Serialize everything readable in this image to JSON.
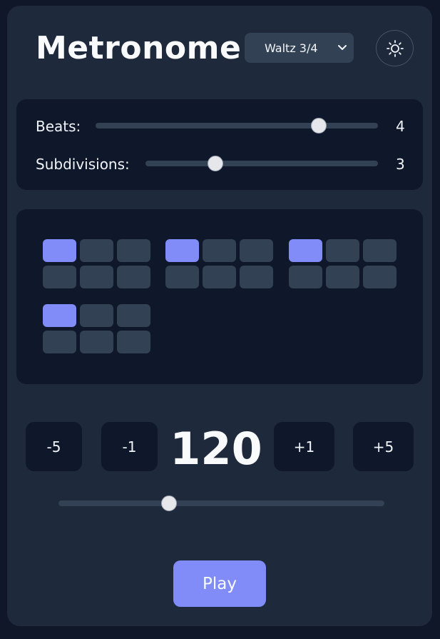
{
  "header": {
    "title": "Metronome",
    "preset_value": "Waltz 3/4",
    "preset_icon": "chevron-down-icon",
    "theme_icon": "sun-icon"
  },
  "controls": {
    "beats_label": "Beats:",
    "beats_value": "4",
    "beats_slider_fraction": 0.79,
    "subdivisions_label": "Subdivisions:",
    "subdivisions_value": "3",
    "subdivisions_slider_fraction": 0.3
  },
  "pattern": {
    "beats": [
      {
        "beat": 1,
        "cells": [
          true,
          false,
          false,
          false,
          false,
          false
        ]
      },
      {
        "beat": 2,
        "cells": [
          true,
          false,
          false,
          false,
          false,
          false
        ]
      },
      {
        "beat": 3,
        "cells": [
          true,
          false,
          false,
          false,
          false,
          false
        ]
      },
      {
        "beat": 4,
        "cells": [
          true,
          false,
          false,
          false,
          false,
          false
        ]
      }
    ]
  },
  "tempo": {
    "bpm": "120",
    "minus5_label": "-5",
    "minus1_label": "-1",
    "plus1_label": "+1",
    "plus5_label": "+5",
    "slider_fraction": 0.34
  },
  "transport": {
    "play_label": "Play"
  },
  "colors": {
    "accent": "#818cf8",
    "card": "#1e293b",
    "panel": "#0f172a",
    "inactive_cell": "#334155"
  }
}
